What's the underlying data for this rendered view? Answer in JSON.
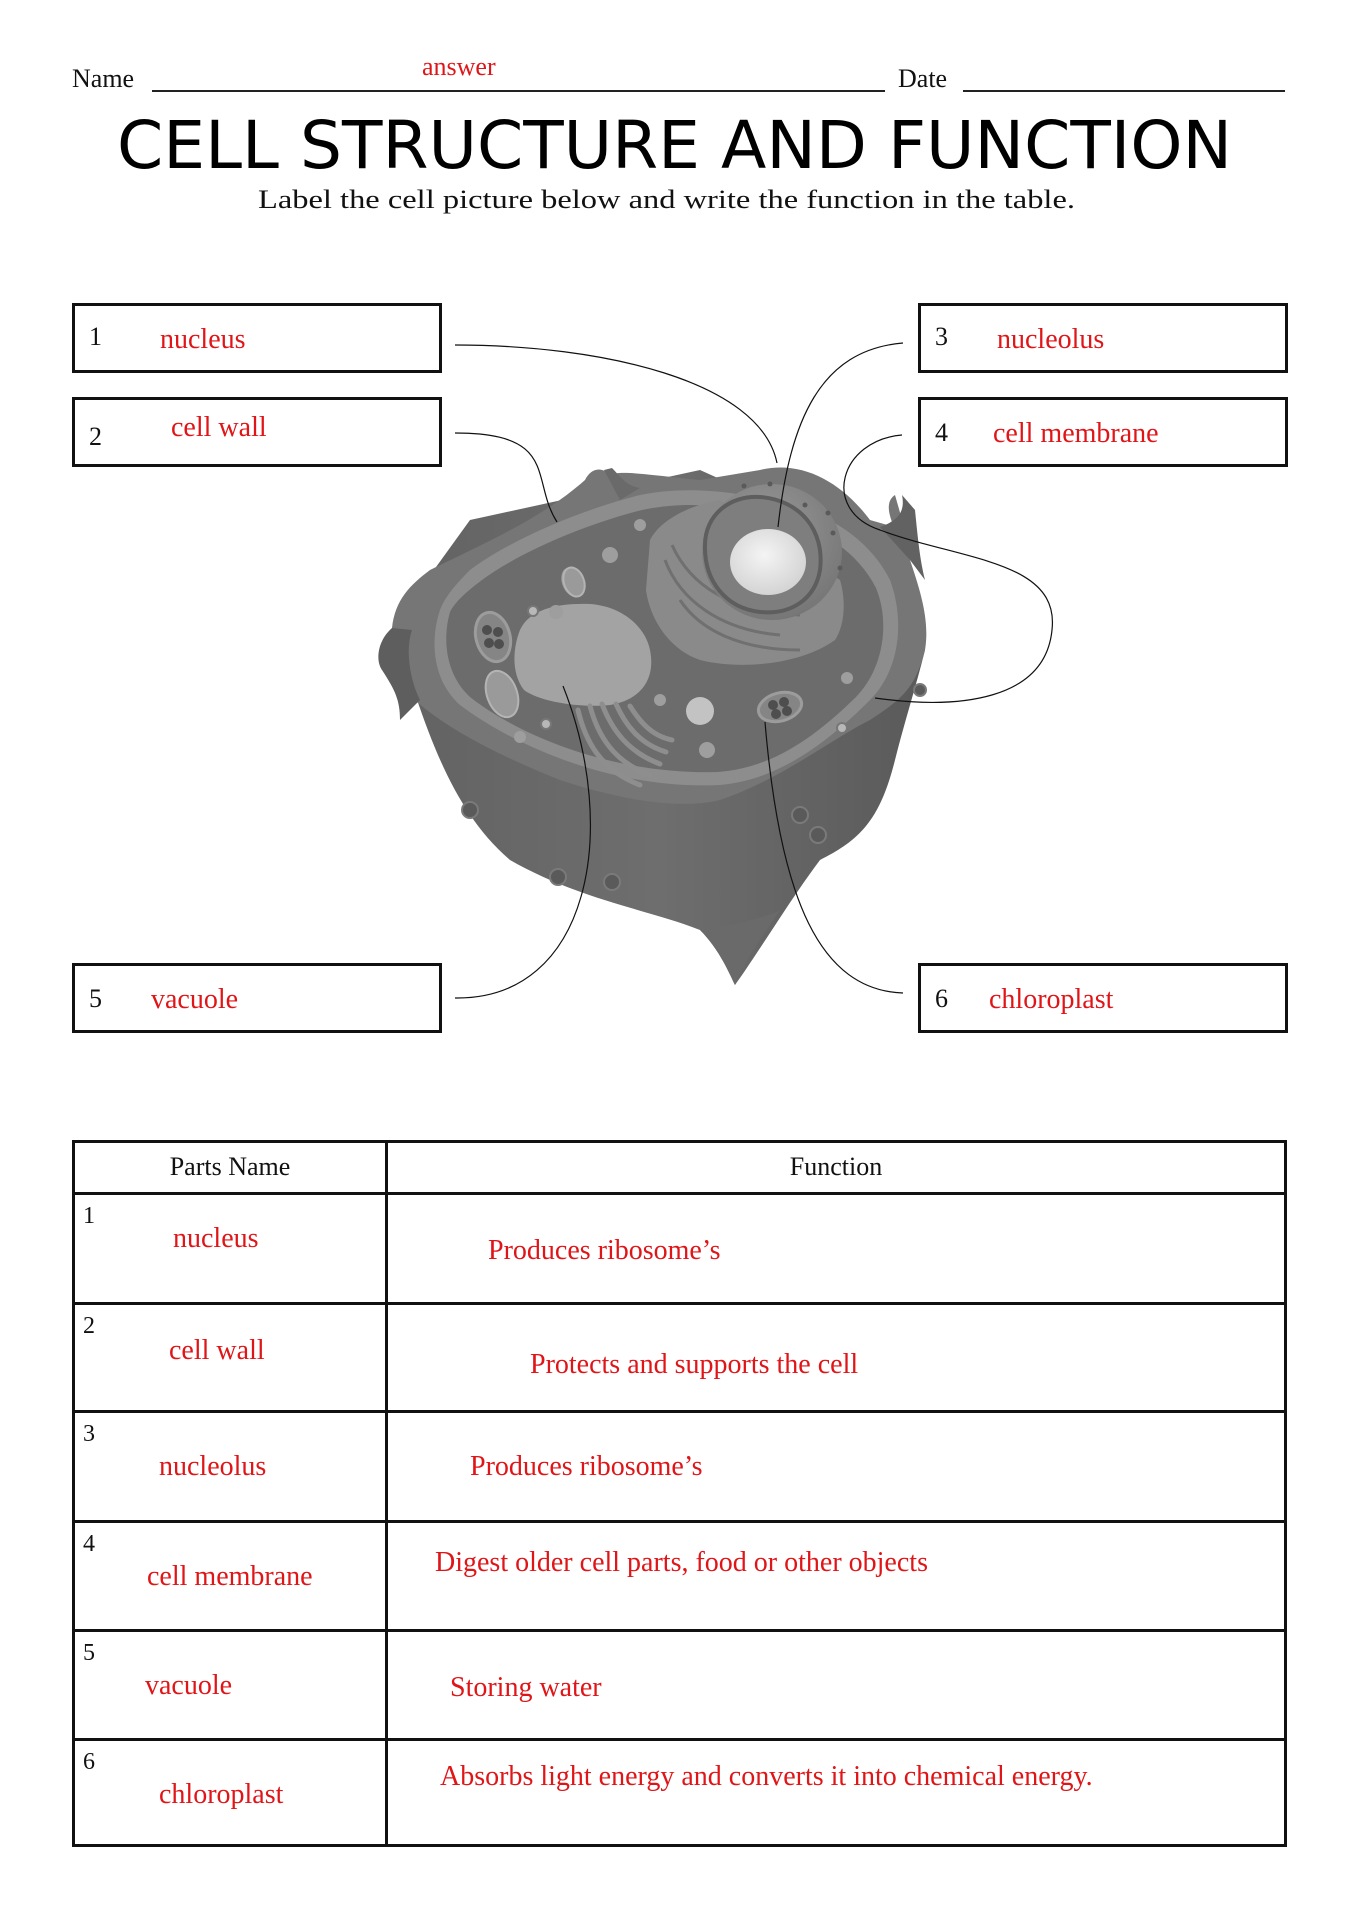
{
  "header": {
    "name_label": "Name",
    "name_answer": "answer",
    "date_label": "Date",
    "title": "CELL STRUCTURE AND FUNCTION",
    "subtitle": "Label the cell picture below and write the function in the table."
  },
  "labels": [
    {
      "number": "1",
      "answer": "nucleus"
    },
    {
      "number": "2",
      "answer": "cell wall"
    },
    {
      "number": "3",
      "answer": "nucleolus"
    },
    {
      "number": "4",
      "answer": "cell membrane"
    },
    {
      "number": "5",
      "answer": "vacuole"
    },
    {
      "number": "6",
      "answer": "chloroplast"
    }
  ],
  "diagram": {
    "subject": "plant cell (grayscale 3D illustration)",
    "colors": {
      "cell_wall": "#6c6c6c",
      "cytoplasm": "#696969",
      "membrane": "#8c8c8c",
      "vacuole": "#a2a2a2",
      "nucleolus": "#e6e6e6",
      "leader_line": "#111111"
    }
  },
  "table": {
    "headers": [
      "Parts Name",
      "Function"
    ],
    "rows": [
      {
        "number": "1",
        "part": "nucleus",
        "function": "Produces ribosome’s"
      },
      {
        "number": "2",
        "part": "cell wall",
        "function": "Protects and supports the cell"
      },
      {
        "number": "3",
        "part": "nucleolus",
        "function": "Produces ribosome’s"
      },
      {
        "number": "4",
        "part": "cell membrane",
        "function": "Digest older cell parts, food or other objects"
      },
      {
        "number": "5",
        "part": "vacuole",
        "function": "Storing water"
      },
      {
        "number": "6",
        "part": "chloroplast",
        "function": "Absorbs light energy and converts it into chemical energy."
      }
    ]
  },
  "theme": {
    "answer_color": "#e01518",
    "ink_color": "#111111"
  }
}
